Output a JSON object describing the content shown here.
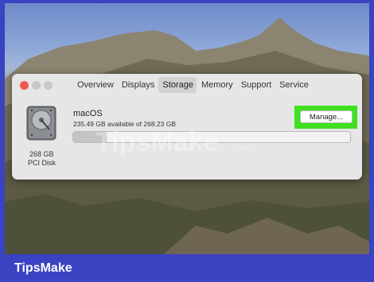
{
  "window": {
    "tabs": [
      {
        "label": "Overview",
        "active": false
      },
      {
        "label": "Displays",
        "active": false
      },
      {
        "label": "Storage",
        "active": true
      },
      {
        "label": "Memory",
        "active": false
      },
      {
        "label": "Support",
        "active": false
      },
      {
        "label": "Service",
        "active": false
      }
    ],
    "disk": {
      "icon": "hard-disk-icon",
      "size": "268 GB",
      "type": "PCI Disk"
    },
    "volume": {
      "name": "macOS",
      "available_text": "235.49 GB available of 268.23 GB",
      "used_fraction": 0.122
    },
    "manage_button_label": "Manage...",
    "highlight_color": "#3ee01f"
  },
  "watermark": {
    "text": "TipsMake",
    "suffix": ".com"
  },
  "footer": {
    "brand": "TipsMake",
    "background": "#3a43c2"
  }
}
